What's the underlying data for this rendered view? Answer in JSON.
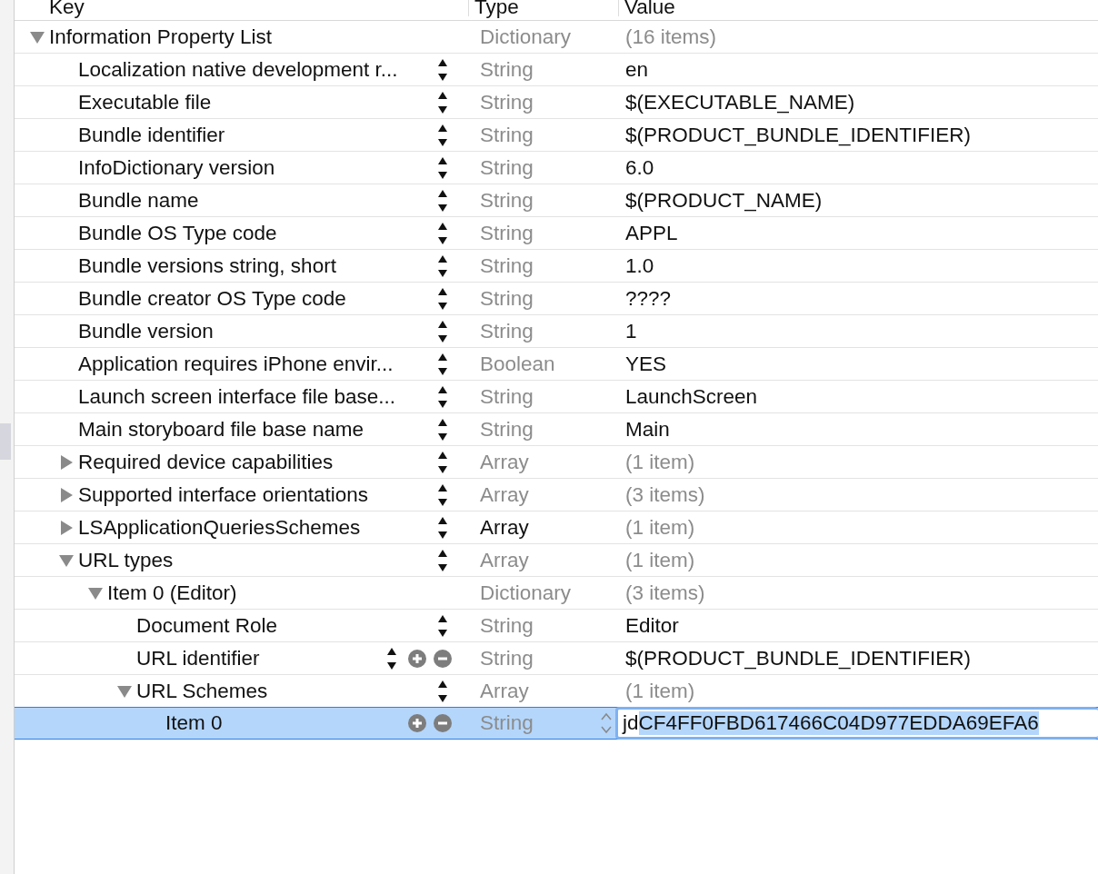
{
  "columns": [
    "Key",
    "Type",
    "Value"
  ],
  "rows": [
    {
      "key": "Information Property List",
      "type": "Dictionary",
      "value": "(16 items)",
      "kind": "collection",
      "expanded": true,
      "stepper": false,
      "add_remove": false,
      "hovered": false,
      "selected": false,
      "children": [
        {
          "key": "Localization native development r...",
          "type": "String",
          "value": "en",
          "kind": "scalar",
          "stepper": true,
          "add_remove": false,
          "hovered": false,
          "selected": false
        },
        {
          "key": "Executable file",
          "type": "String",
          "value": "$(EXECUTABLE_NAME)",
          "kind": "scalar",
          "stepper": true,
          "add_remove": false,
          "hovered": false,
          "selected": false
        },
        {
          "key": "Bundle identifier",
          "type": "String",
          "value": "$(PRODUCT_BUNDLE_IDENTIFIER)",
          "kind": "scalar",
          "stepper": true,
          "add_remove": false,
          "hovered": false,
          "selected": false
        },
        {
          "key": "InfoDictionary version",
          "type": "String",
          "value": "6.0",
          "kind": "scalar",
          "stepper": true,
          "add_remove": false,
          "hovered": false,
          "selected": false
        },
        {
          "key": "Bundle name",
          "type": "String",
          "value": "$(PRODUCT_NAME)",
          "kind": "scalar",
          "stepper": true,
          "add_remove": false,
          "hovered": false,
          "selected": false
        },
        {
          "key": "Bundle OS Type code",
          "type": "String",
          "value": "APPL",
          "kind": "scalar",
          "stepper": true,
          "add_remove": false,
          "hovered": false,
          "selected": false
        },
        {
          "key": "Bundle versions string, short",
          "type": "String",
          "value": "1.0",
          "kind": "scalar",
          "stepper": true,
          "add_remove": false,
          "hovered": false,
          "selected": false
        },
        {
          "key": "Bundle creator OS Type code",
          "type": "String",
          "value": "????",
          "kind": "scalar",
          "stepper": true,
          "add_remove": false,
          "hovered": false,
          "selected": false
        },
        {
          "key": "Bundle version",
          "type": "String",
          "value": "1",
          "kind": "scalar",
          "stepper": true,
          "add_remove": false,
          "hovered": false,
          "selected": false
        },
        {
          "key": "Application requires iPhone envir...",
          "type": "Boolean",
          "value": "YES",
          "kind": "scalar",
          "stepper": true,
          "add_remove": false,
          "hovered": false,
          "selected": false
        },
        {
          "key": "Launch screen interface file base...",
          "type": "String",
          "value": "LaunchScreen",
          "kind": "scalar",
          "stepper": true,
          "add_remove": false,
          "hovered": false,
          "selected": false
        },
        {
          "key": "Main storyboard file base name",
          "type": "String",
          "value": "Main",
          "kind": "scalar",
          "stepper": true,
          "add_remove": false,
          "hovered": false,
          "selected": false
        },
        {
          "key": "Required device capabilities",
          "type": "Array",
          "value": "(1 item)",
          "kind": "collection",
          "expanded": false,
          "stepper": true,
          "add_remove": false,
          "hovered": false,
          "selected": false
        },
        {
          "key": "Supported interface orientations",
          "type": "Array",
          "value": "(3 items)",
          "kind": "collection",
          "expanded": false,
          "stepper": true,
          "add_remove": false,
          "hovered": false,
          "selected": false
        },
        {
          "key": "LSApplicationQueriesSchemes",
          "type": "Array",
          "value": "(1 item)",
          "kind": "collection",
          "expanded": false,
          "stepper": true,
          "add_remove": false,
          "hovered": true,
          "selected": false
        },
        {
          "key": "URL types",
          "type": "Array",
          "value": "(1 item)",
          "kind": "collection",
          "expanded": true,
          "stepper": true,
          "add_remove": false,
          "hovered": false,
          "selected": false,
          "children": [
            {
              "key": "Item 0 (Editor)",
              "type": "Dictionary",
              "value": "(3 items)",
              "kind": "collection",
              "expanded": true,
              "stepper": false,
              "add_remove": false,
              "hovered": false,
              "selected": false,
              "children": [
                {
                  "key": "Document Role",
                  "type": "String",
                  "value": "Editor",
                  "kind": "scalar",
                  "stepper": true,
                  "add_remove": false,
                  "hovered": false,
                  "selected": false
                },
                {
                  "key": "URL identifier",
                  "type": "String",
                  "value": "$(PRODUCT_BUNDLE_IDENTIFIER)",
                  "kind": "scalar",
                  "stepper": true,
                  "add_remove": true,
                  "hovered": false,
                  "selected": false
                },
                {
                  "key": "URL Schemes",
                  "type": "Array",
                  "value": "(1 item)",
                  "kind": "collection",
                  "expanded": true,
                  "stepper": true,
                  "add_remove": false,
                  "hovered": false,
                  "selected": false,
                  "children": [
                    {
                      "key": "Item 0",
                      "type": "String",
                      "kind": "editing",
                      "stepper": false,
                      "add_remove": true,
                      "hovered": false,
                      "selected": true,
                      "value_parts": [
                        {
                          "text": "jd",
                          "selected": false
                        },
                        {
                          "text": "CF4FF0FBD617466C04D977EDDA69EFA6",
                          "selected": true
                        }
                      ]
                    }
                  ]
                }
              ]
            }
          ]
        }
      ]
    }
  ]
}
